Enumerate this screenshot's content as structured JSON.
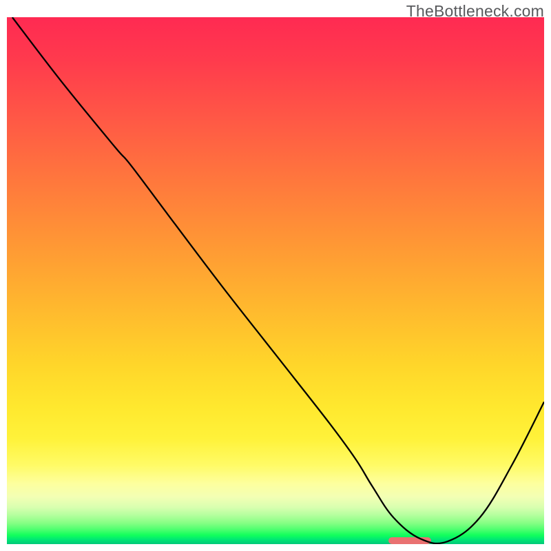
{
  "watermark": "TheBottleneck.com",
  "chart_data": {
    "type": "line",
    "title": "",
    "xlabel": "",
    "ylabel": "",
    "xlim": [
      0,
      100
    ],
    "ylim": [
      0,
      100
    ],
    "x": [
      1,
      10,
      20,
      23,
      30,
      40,
      50,
      60,
      65,
      68,
      72,
      77,
      82,
      88,
      94,
      100
    ],
    "values": [
      100,
      88,
      75.5,
      72,
      62.5,
      49,
      36,
      23,
      16,
      11,
      5,
      1,
      0.5,
      5,
      15,
      27
    ],
    "optimal_zone": {
      "x_start": 71,
      "x_end": 79,
      "y": 0
    },
    "background": "vertical red→orange→yellow→green gradient (low values at bottom = green)"
  }
}
